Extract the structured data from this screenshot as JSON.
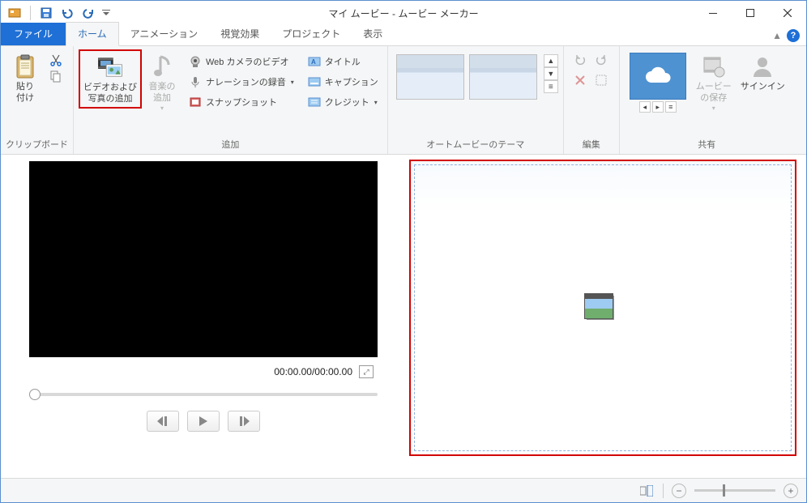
{
  "title": "マイ ムービー - ムービー メーカー",
  "tabs": {
    "file": "ファイル",
    "home": "ホーム",
    "animation": "アニメーション",
    "visual": "視覚効果",
    "project": "プロジェクト",
    "view": "表示"
  },
  "ribbon": {
    "clipboard": {
      "paste": "貼り\n付け",
      "group": "クリップボード"
    },
    "add": {
      "add_media": "ビデオおよび\n写真の追加",
      "add_music": "音楽の\n追加",
      "webcam": "Web カメラのビデオ",
      "narration": "ナレーションの録音",
      "snapshot": "スナップショット",
      "title": "タイトル",
      "caption": "キャプション",
      "credit": "クレジット",
      "group": "追加"
    },
    "automovie": {
      "group": "オートムービーのテーマ"
    },
    "edit": {
      "group": "編集"
    },
    "share": {
      "save": "ムービー\nの保存",
      "signin": "サインイン",
      "group": "共有"
    }
  },
  "preview": {
    "time": "00:00.00/00:00.00"
  },
  "storyboard": {
    "placeholder_hint": ""
  }
}
